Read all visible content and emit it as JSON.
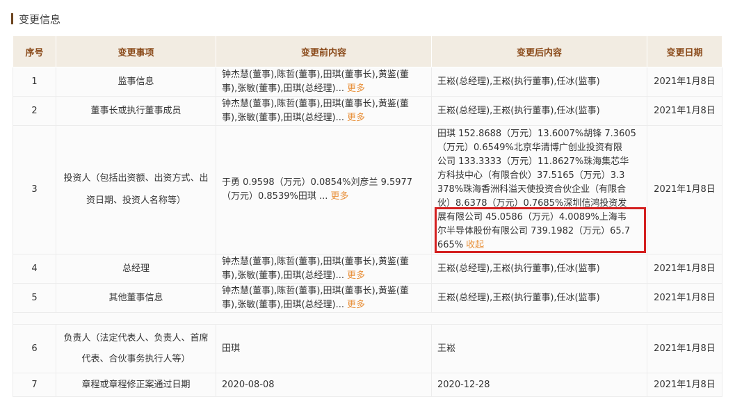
{
  "section": {
    "title": "变更信息"
  },
  "table": {
    "headers": [
      "序号",
      "变更事项",
      "变更前内容",
      "变更后内容",
      "变更日期"
    ],
    "more_label": "更多",
    "collapse_label": "收起",
    "rows": [
      {
        "no": "1",
        "item": "监事信息",
        "before_line1": "钟杰慧(董事),陈哲(董事),田琪(董事长),黄鉴(董",
        "before_line2": "事),张敏(董事),田琪(总经理)...",
        "after": "王崧(总经理),王崧(执行董事),任冰(监事)",
        "date": "2021年1月8日"
      },
      {
        "no": "2",
        "item": "董事长或执行董事成员",
        "before_line1": "钟杰慧(董事),陈哲(董事),田琪(董事长),黄鉴(董",
        "before_line2": "事),张敏(董事),田琪(总经理)...",
        "after": "王崧(总经理),王崧(执行董事),任冰(监事)",
        "date": "2021年1月8日"
      },
      {
        "no": "3",
        "item_line1": "投资人（包括出资额、出资方式、出",
        "item_line2": "资日期、投资人名称等）",
        "before_line1": "于勇 0.9598（万元）0.0854%刘彦兰 9.5977",
        "before_line2": "（万元）0.8539%田琪 ...",
        "after_lines": [
          "田琪 152.8688（万元）13.6007%胡锋 7.3605",
          "（万元）0.6549%北京华清博广创业投资有限",
          "公司 133.3333（万元）11.8627%珠海集芯华",
          "方科技中心（有限合伙）37.5165（万元）3.3",
          "378%珠海香洲科溢天使投资合伙企业（有限合",
          "伙）8.6378（万元）0.7685%深圳信鸿投资发",
          "展有限公司 45.0586（万元）4.0089%上海韦",
          "尔半导体股份有限公司 739.1982（万元）65.7",
          "665%"
        ],
        "date": "2021年1月8日"
      },
      {
        "no": "4",
        "item": "总经理",
        "before_line1": "钟杰慧(董事),陈哲(董事),田琪(董事长),黄鉴(董",
        "before_line2": "事),张敏(董事),田琪(总经理)...",
        "after": "王崧(总经理),王崧(执行董事),任冰(监事)",
        "date": "2021年1月8日"
      },
      {
        "no": "5",
        "item": "其他董事信息",
        "before_line1": "钟杰慧(董事),陈哲(董事),田琪(董事长),黄鉴(董",
        "before_line2": "事),张敏(董事),田琪(总经理)...",
        "after": "王崧(总经理),王崧(执行董事),任冰(监事)",
        "date": "2021年1月8日"
      },
      {
        "no": "6",
        "item_line1": "负责人（法定代表人、负责人、首席",
        "item_line2": "代表、合伙事务执行人等）",
        "before": "田琪",
        "after": "王崧",
        "date": "2021年1月8日"
      },
      {
        "no": "7",
        "item": "章程或章程修正案通过日期",
        "before": "2020-08-08",
        "after": "2020-12-28",
        "date": "2021年1月8日"
      }
    ]
  },
  "colors": {
    "header_bg": "#f2ece2",
    "header_text": "#8a4a1a",
    "more_link": "#e8903a",
    "highlight_box": "#d42020",
    "title_bar": "#6e4520"
  }
}
